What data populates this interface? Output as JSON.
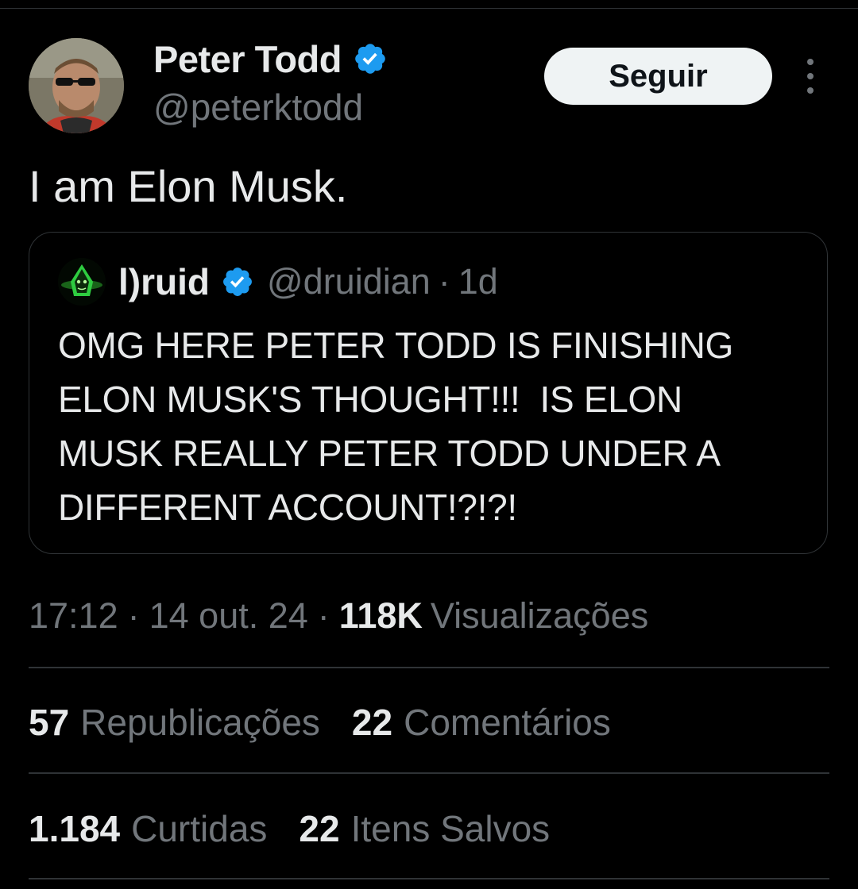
{
  "author": {
    "name": "Peter Todd",
    "handle": "@peterktodd",
    "follow_label": "Seguir"
  },
  "tweet": {
    "text": "I am Elon Musk."
  },
  "quoted_tweet": {
    "name": "l)ruid",
    "handle": "@druidian",
    "separator": "·",
    "age": "1d",
    "text_lines": [
      "OMG HERE PETER TODD IS FINISHING",
      "ELON MUSK'S THOUGHT!!!  IS ELON",
      "MUSK REALLY PETER TODD UNDER A",
      "DIFFERENT ACCOUNT!?!?!"
    ]
  },
  "meta": {
    "time": "17:12",
    "date": "14 out. 24",
    "separator": "·",
    "views_count": "118K",
    "views_label": "Visualizações"
  },
  "stats": {
    "reposts_count": "57",
    "reposts_label": "Republicações",
    "comments_count": "22",
    "comments_label": "Comentários",
    "likes_count": "1.184",
    "likes_label": "Curtidas",
    "saves_count": "22",
    "saves_label": "Itens Salvos"
  },
  "colors": {
    "background": "#000000",
    "text_primary": "#e7e9ea",
    "text_secondary": "#71767b",
    "divider": "#2f3336",
    "verified_badge": "#1d9bf0",
    "follow_button_bg": "#eff3f4"
  },
  "icons": {
    "verified": "verified-badge-icon",
    "more": "more-options-icon"
  }
}
